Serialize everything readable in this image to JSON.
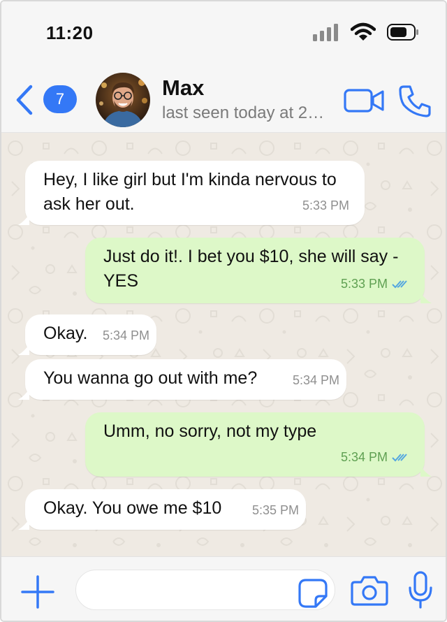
{
  "status_bar": {
    "time": "11:20"
  },
  "header": {
    "unread_count": "7",
    "contact_name": "Max",
    "last_seen": "last seen today at 2…"
  },
  "messages": [
    {
      "direction": "in",
      "text": "Hey, I like girl but I'm kinda nervous to ask her out.",
      "time": "5:33 PM"
    },
    {
      "direction": "out",
      "text": "Just do it!. I bet you $10, she will say - YES",
      "time": "5:33 PM",
      "status": "read"
    },
    {
      "direction": "in",
      "text": "Okay.",
      "time": "5:34 PM"
    },
    {
      "direction": "in",
      "text": "You wanna go out with me?",
      "time": "5:34 PM"
    },
    {
      "direction": "out",
      "text": "Umm, no sorry, not my type",
      "time": "5:34 PM",
      "status": "read"
    },
    {
      "direction": "in",
      "text": "Okay. You owe me $10",
      "time": "5:35 PM"
    }
  ],
  "input": {
    "placeholder": ""
  },
  "colors": {
    "accent": "#3478f6",
    "incoming_bubble": "#ffffff",
    "outgoing_bubble": "#ddf8c8",
    "chat_background": "#efeae3"
  },
  "icons": [
    "back-chevron-icon",
    "video-call-icon",
    "phone-call-icon",
    "plus-icon",
    "sticker-icon",
    "camera-icon",
    "microphone-icon",
    "signal-icon",
    "wifi-icon",
    "battery-icon",
    "double-check-icon"
  ]
}
